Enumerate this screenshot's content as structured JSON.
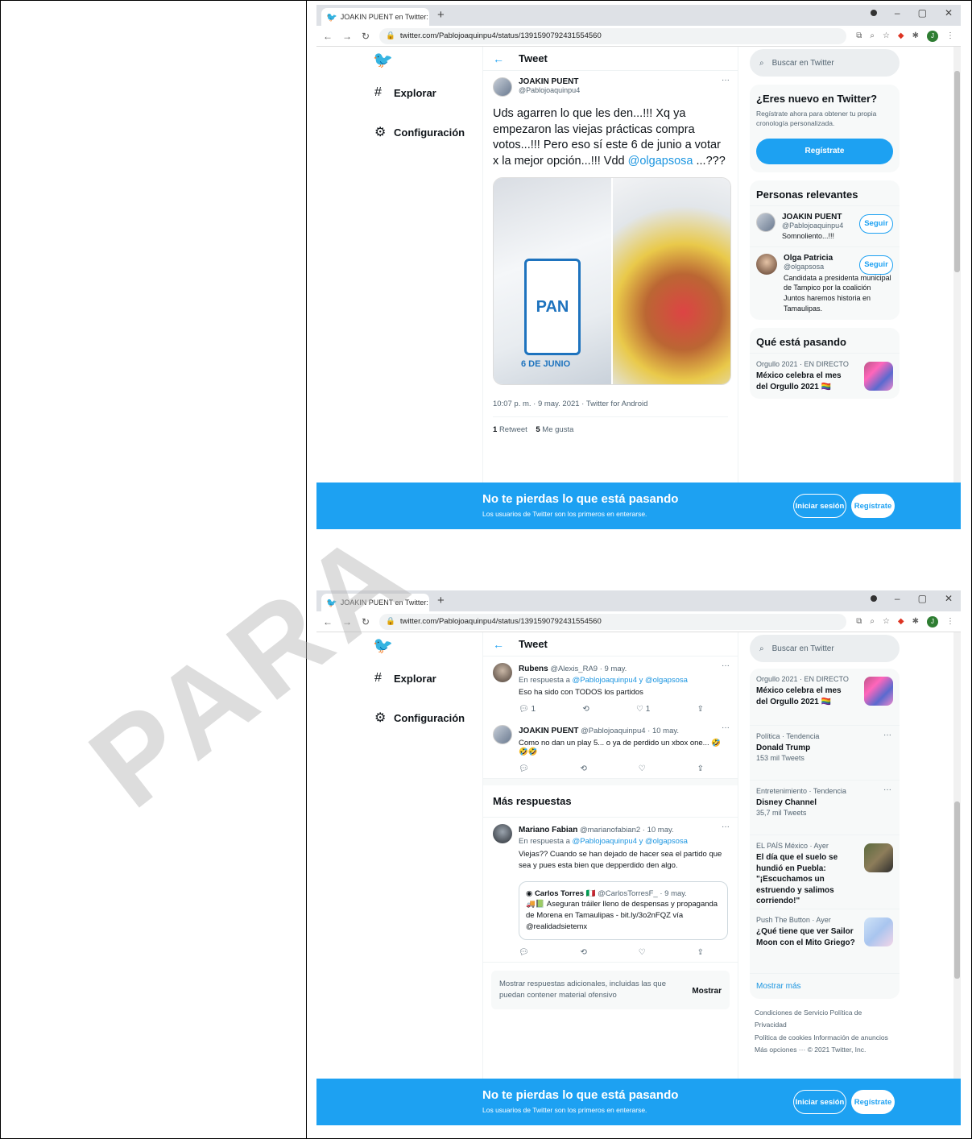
{
  "browser": {
    "tab_title": "JOAKIN PUENT en Twitter: \"Uds :",
    "tab_close": "X",
    "new_tab": "+",
    "url": "twitter.com/Pablojoaquinpu4/status/1391590792431554560",
    "profile_initial": "J"
  },
  "nav": {
    "explore": "Explorar",
    "settings": "Configuración"
  },
  "header": {
    "title": "Tweet"
  },
  "search": {
    "placeholder": "Buscar en Twitter"
  },
  "main_tweet": {
    "name": "JOAKIN PUENT",
    "handle": "@Pablojoaquinpu4",
    "text": "Uds agarren lo que les den...!!! Xq ya empezaron las viejas prácticas compra votos...!!! Pero eso sí este 6 de junio a votar x la mejor opción...!!! Vdd",
    "mention": "@olgapsosa",
    "text_tail": "...???",
    "image_text_1": "PAN",
    "image_text_2": "6 DE JUNIO",
    "meta": "10:07 p. m. · 9 may. 2021 · Twitter for Android",
    "retweets": "1",
    "retweets_label": "Retweet",
    "likes": "5",
    "likes_label": "Me gusta"
  },
  "new_card": {
    "title": "¿Eres nuevo en Twitter?",
    "subtitle": "Regístrate ahora para obtener tu propia cronología personalizada.",
    "button": "Regístrate"
  },
  "relevant": {
    "title": "Personas relevantes",
    "people": [
      {
        "name": "JOAKIN PUENT",
        "handle": "@Pablojoaquinpu4",
        "bio": "Somnoliento...!!!",
        "button": "Seguir"
      },
      {
        "name": "Olga Patricia",
        "handle": "@olgapsosa",
        "bio": "Candidata a presidenta municipal de Tampico por la coalición Juntos haremos historia en Tamaulipas.",
        "button": "Seguir"
      }
    ]
  },
  "happening": {
    "title": "Qué está pasando",
    "trends": [
      {
        "context": "Orgullo 2021 · EN DIRECTO",
        "title": "México celebra el mes del Orgullo 2021 🏳️‍🌈"
      },
      {
        "context": "Política · Tendencia",
        "title": "Donald Trump",
        "count": "153 mil Tweets"
      },
      {
        "context": "Entretenimiento · Tendencia",
        "title": "Disney Channel",
        "count": "35,7 mil Tweets"
      },
      {
        "context": "EL PAÍS México · Ayer",
        "title": "El día que el suelo se hundió en Puebla: \"¡Escuchamos un estruendo y salimos corriendo!\""
      },
      {
        "context": "Push The Button · Ayer",
        "title": "¿Qué tiene que ver Sailor Moon con el Mito Griego?"
      }
    ],
    "show_more": "Mostrar más"
  },
  "replies": [
    {
      "name": "Rubens",
      "handle": "@Alexis_RA9 · 9 may.",
      "reply_to_prefix": "En respuesta a",
      "reply_to": "@Pablojoaquinpu4 y @olgapsosa",
      "text": "Eso ha sido con TODOS los partidos",
      "replies": "1",
      "likes": "1"
    },
    {
      "name": "JOAKIN PUENT",
      "handle": "@Pablojoaquinpu4 · 10 may.",
      "text": "Como no dan un play 5... o ya de perdido un xbox one... 🤣🤣🤣"
    }
  ],
  "more_replies": {
    "title": "Más respuestas",
    "reply": {
      "name": "Mariano Fabian",
      "handle": "@marianofabian2 · 10 may.",
      "reply_to_prefix": "En respuesta a",
      "reply_to": "@Pablojoaquinpu4 y @olgapsosa",
      "text": "Viejas?? Cuando se han dejado de hacer sea el partido que sea y pues esta bien que depperdido den algo.",
      "quote_name": "Carlos Torres 🇮🇹",
      "quote_handle": "@CarlosTorresF_ · 9 may.",
      "quote_text": "🚚📗 Aseguran tráiler lleno de despensas y propaganda de Morena en Tamaulipas - bit.ly/3o2nFQZ vía @realidadsietemx"
    },
    "offensive_text": "Mostrar respuestas adicionales, incluidas las que puedan contener material ofensivo",
    "offensive_button": "Mostrar"
  },
  "footer": {
    "line1": "Condiciones de Servicio   Política de Privacidad",
    "line2": "Política de cookies   Información de anuncios",
    "line3": "Más opciones ···   © 2021 Twitter, Inc."
  },
  "bottom_bar": {
    "title": "No te pierdas lo que está pasando",
    "subtitle": "Los usuarios de Twitter son los primeros en enterarse.",
    "login": "Iniciar sesión",
    "signup": "Regístrate"
  },
  "watermark": "PARA",
  "colors": {
    "twitter_blue": "#1da1f2",
    "chrome_tabstrip": "#dee1e6"
  }
}
